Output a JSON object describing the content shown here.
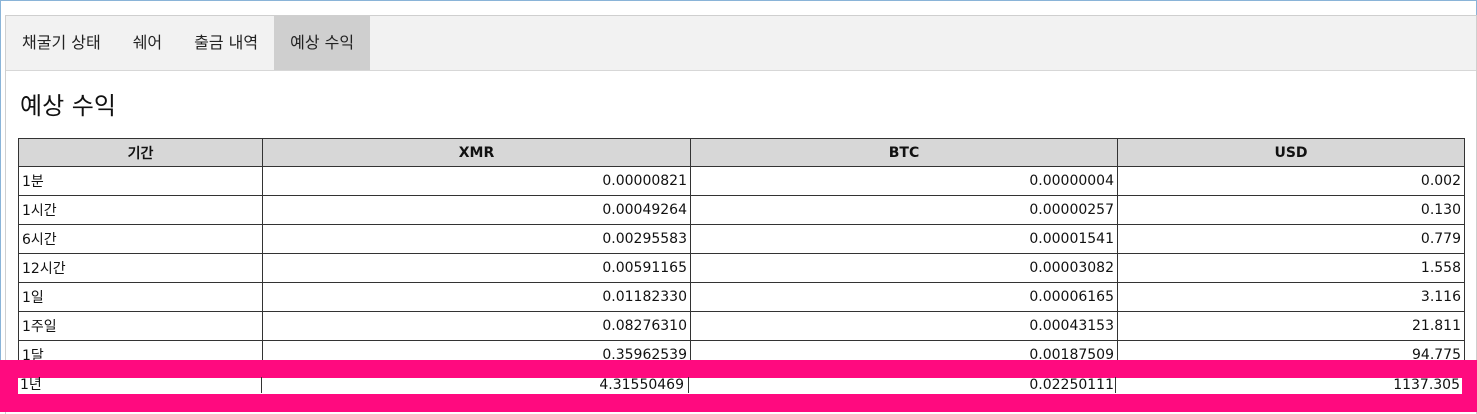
{
  "tabs": [
    {
      "label": "채굴기 상태",
      "active": false
    },
    {
      "label": "쉐어",
      "active": false
    },
    {
      "label": "출금 내역",
      "active": false
    },
    {
      "label": "예상 수익",
      "active": true
    }
  ],
  "section_title": "예상 수익",
  "table": {
    "columns": [
      "기간",
      "XMR",
      "BTC",
      "USD"
    ],
    "rows": [
      {
        "period": "1분",
        "xmr": "0.00000821",
        "btc": "0.00000004",
        "usd": "0.002"
      },
      {
        "period": "1시간",
        "xmr": "0.00049264",
        "btc": "0.00000257",
        "usd": "0.130"
      },
      {
        "period": "6시간",
        "xmr": "0.00295583",
        "btc": "0.00001541",
        "usd": "0.779"
      },
      {
        "period": "12시간",
        "xmr": "0.00591165",
        "btc": "0.00003082",
        "usd": "1.558"
      },
      {
        "period": "1일",
        "xmr": "0.01182330",
        "btc": "0.00006165",
        "usd": "3.116"
      },
      {
        "period": "1주일",
        "xmr": "0.08276310",
        "btc": "0.00043153",
        "usd": "21.811"
      },
      {
        "period": "1달",
        "xmr": "0.35962539",
        "btc": "0.00187509",
        "usd": "94.775"
      },
      {
        "period": "1년",
        "xmr": "4.31550469",
        "btc": "0.02250111",
        "usd": "1137.305"
      }
    ]
  },
  "colors": {
    "highlight_band": "#ff0a7f",
    "tab_active_bg": "#cfcfcf",
    "header_bg": "#d7d7d7"
  }
}
